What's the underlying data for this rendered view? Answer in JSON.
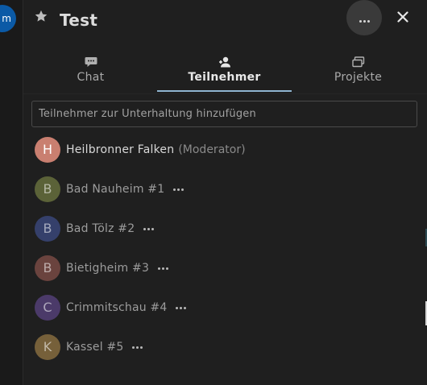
{
  "sidebar_avatar": {
    "label": "m",
    "color": "#0b5aa6"
  },
  "header": {
    "title": "Test",
    "favorite_icon": "star-icon",
    "more_icon": "ellipsis-icon",
    "close_icon": "close-icon"
  },
  "tabs": [
    {
      "label": "Chat",
      "icon": "chat-bubble-icon",
      "active": false
    },
    {
      "label": "Teilnehmer",
      "icon": "participants-icon",
      "active": true
    },
    {
      "label": "Projekte",
      "icon": "projects-icon",
      "active": false
    }
  ],
  "search": {
    "placeholder": "Teilnehmer zur Unterhaltung hinzufügen"
  },
  "participants": [
    {
      "initial": "H",
      "name": "Heilbronner Falken",
      "role": "(Moderator)",
      "color": "#c97f70"
    },
    {
      "initial": "B",
      "name": "Bad Nauheim #1",
      "role": "",
      "color": "#5b6238"
    },
    {
      "initial": "B",
      "name": "Bad Tölz #2",
      "role": "",
      "color": "#35406b"
    },
    {
      "initial": "B",
      "name": "Bietigheim #3",
      "role": "",
      "color": "#6a433e"
    },
    {
      "initial": "C",
      "name": "Crimmitschau #4",
      "role": "",
      "color": "#4b3a69"
    },
    {
      "initial": "K",
      "name": "Kassel #5",
      "role": "",
      "color": "#76603a"
    }
  ]
}
